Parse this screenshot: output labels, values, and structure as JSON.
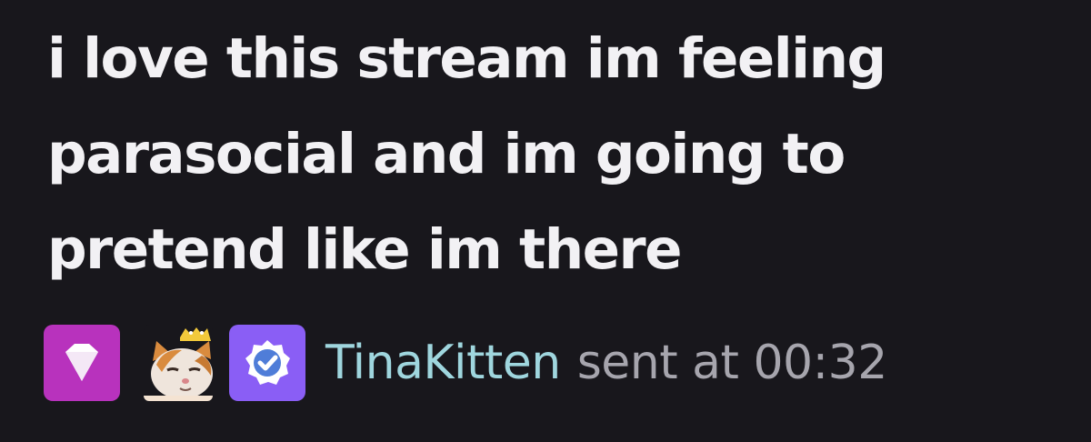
{
  "message": {
    "text": "i love this stream im feeling parasocial and im going to pretend like im there"
  },
  "author": {
    "username": "TinaKitten",
    "username_color": "#9fd6de"
  },
  "meta": {
    "sent_label": "sent at",
    "time": "00:32"
  },
  "badges": [
    {
      "icon": "diamond-icon",
      "color": "#b832bd"
    },
    {
      "icon": "cat-emote-icon"
    },
    {
      "icon": "verified-check-icon",
      "color": "#8a5ef5"
    }
  ],
  "colors": {
    "background": "#18171c",
    "message_text": "#f2f1f4",
    "meta_text": "#a6a5ad"
  }
}
